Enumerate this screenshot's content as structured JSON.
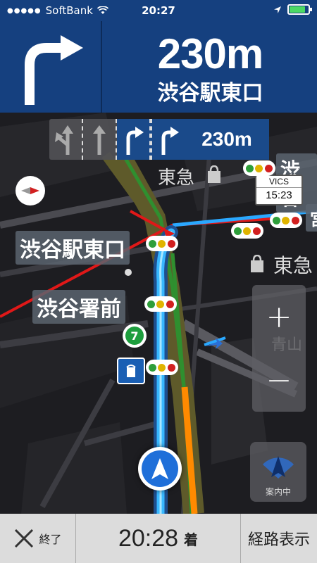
{
  "status_bar": {
    "carrier": "SoftBank",
    "time": "20:27"
  },
  "guidance": {
    "distance": "230m",
    "destination": "渋谷駅東口",
    "direction_icon": "turn-right-arrow-icon"
  },
  "lane_guidance": {
    "lanes": [
      "left-straight",
      "straight",
      "right",
      "right"
    ],
    "distance": "230m"
  },
  "map": {
    "labels": {
      "tokyu_1": "東急",
      "tokyu_2": "東急",
      "shibuya_east": "渋谷駅東口",
      "shibuya_police": "渋谷署前",
      "shibuya_cut": "渋谷",
      "aoyama": "青山",
      "miya": "宮"
    },
    "vics": {
      "title": "VICS",
      "time": "15:23"
    },
    "zoom": {
      "in": "+",
      "out": "−"
    },
    "guidance_mode": "案内中"
  },
  "footer": {
    "end_label": "終了",
    "arrival_time": "20:28",
    "arrival_suffix": "着",
    "route_label": "経路表示"
  },
  "colors": {
    "header_bg": "#15407f",
    "route": "#2aa8ff",
    "congestion_red": "#e01818",
    "congestion_orange": "#ff8a00"
  }
}
